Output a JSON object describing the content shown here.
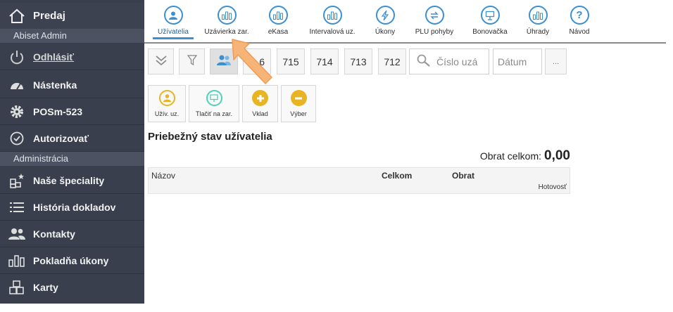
{
  "sidebar": {
    "brand": "Predaj",
    "user_section": "Abiset Admin",
    "logout": "Odhlásiť",
    "items_top": [
      {
        "label": "Nástenka",
        "icon": "dashboard-gauge-icon"
      },
      {
        "label": "POSm-523",
        "icon": "gear-icon"
      },
      {
        "label": "Autorizovať",
        "icon": "check-circle-icon"
      }
    ],
    "admin_section": "Administrácia",
    "items_admin": [
      {
        "label": "Naše špeciality",
        "icon": "starred-boxes-icon"
      },
      {
        "label": "História dokladov",
        "icon": "list-icon"
      },
      {
        "label": "Kontakty",
        "icon": "users-icon"
      },
      {
        "label": "Pokladňa úkony",
        "icon": "bar-chart-icon"
      },
      {
        "label": "Karty",
        "icon": "boxes-icon"
      }
    ]
  },
  "topnav": {
    "items": [
      {
        "label": "Užívatelia",
        "icon": "user-icon",
        "active": true
      },
      {
        "label": "Uzávierka zar.",
        "icon": "bar-chart-icon"
      },
      {
        "label": "eKasa",
        "icon": "bar-chart-icon"
      },
      {
        "label": "Intervalová uz.",
        "icon": "bar-chart-icon"
      },
      {
        "label": "Úkony",
        "icon": "lightning-icon"
      },
      {
        "label": "PLU pohyby",
        "icon": "exchange-icon"
      },
      {
        "label": "Bonovačka",
        "icon": "presentation-icon"
      },
      {
        "label": "Úhrady",
        "icon": "bar-chart-icon"
      },
      {
        "label": "Návod",
        "icon": "question-icon"
      }
    ]
  },
  "toolbar": {
    "numbers": [
      "6",
      "715",
      "714",
      "713",
      "712"
    ],
    "search_placeholder": "Číslo uzá",
    "date_placeholder": "Dátum",
    "more": "..."
  },
  "actions": [
    {
      "label": "Užív. uz.",
      "color": "#e8b423",
      "icon": "user-icon"
    },
    {
      "label": "Tlačiť na zar.",
      "color": "#4fd1b9",
      "icon": "presentation-icon"
    },
    {
      "label": "Vklad",
      "color": "#e8b423",
      "icon": "plus-icon"
    },
    {
      "label": "Výber",
      "color": "#e8b423",
      "icon": "minus-icon"
    }
  ],
  "content": {
    "title": "Priebežný stav užívatelia",
    "turnover_label": "Obrat celkom:",
    "turnover_value": "0,00",
    "columns": {
      "name": "Názov",
      "total": "Celkom",
      "turnover": "Obrat",
      "cash": "Hotovosť"
    }
  },
  "colors": {
    "sidebar": "#3a3f4d",
    "accent": "#3c8fd0",
    "yellow": "#e8b423",
    "teal": "#4fd1b9",
    "arrow": "#f7b477"
  }
}
